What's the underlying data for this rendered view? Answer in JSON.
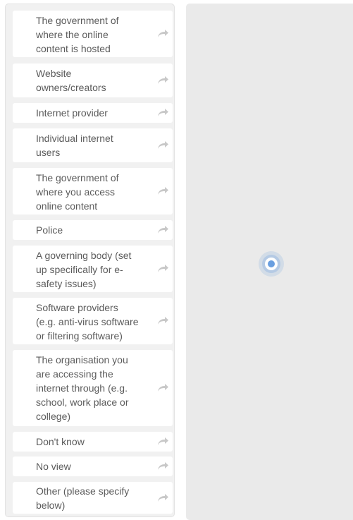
{
  "options": [
    {
      "label": "The government of\nwhere the online\ncontent is hosted",
      "icon": "share-arrow-icon"
    },
    {
      "label": "Website\nowners/creators",
      "icon": "share-arrow-icon"
    },
    {
      "label": "Internet provider",
      "icon": "share-arrow-icon"
    },
    {
      "label": "Individual internet\nusers",
      "icon": "share-arrow-icon"
    },
    {
      "label": "The government of\nwhere you access\nonline content",
      "icon": "share-arrow-icon"
    },
    {
      "label": "Police",
      "icon": "share-arrow-icon"
    },
    {
      "label": "A governing body (set\nup specifically for e-\nsafety issues)",
      "icon": "share-arrow-icon"
    },
    {
      "label": "Software providers\n(e.g. anti-virus software\nor filtering software)",
      "icon": "share-arrow-icon"
    },
    {
      "label": "The organisation you\nare accessing the\ninternet through (e.g.\nschool, work place or\ncollege)",
      "icon": "share-arrow-icon"
    },
    {
      "label": "Don't know",
      "icon": "share-arrow-icon"
    },
    {
      "label": "No view",
      "icon": "share-arrow-icon"
    },
    {
      "label": "Other (please specify\nbelow)",
      "icon": "share-arrow-icon"
    }
  ],
  "drop_zone": {
    "icon": "target-dot-icon"
  },
  "colors": {
    "accent": "#6a9fe0",
    "panel": "#f1f1f1",
    "drop_zone": "#eaeaea",
    "text": "#5b5b5b"
  }
}
